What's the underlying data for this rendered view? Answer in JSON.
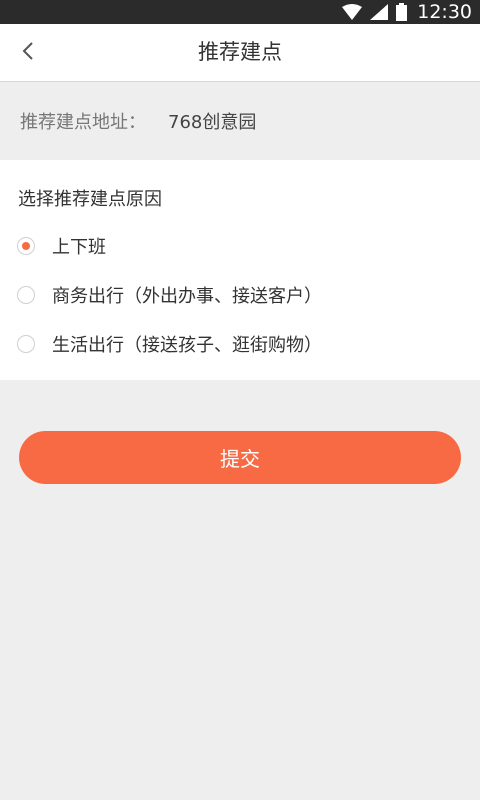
{
  "status_bar": {
    "time": "12:30",
    "icons": [
      "wifi-icon",
      "cell-signal-icon",
      "battery-icon"
    ]
  },
  "header": {
    "back_icon": "chevron-left-icon",
    "title": "推荐建点"
  },
  "address": {
    "label": "推荐建点地址：",
    "value": "768创意园"
  },
  "reason": {
    "title": "选择推荐建点原因",
    "options": [
      {
        "label": "上下班",
        "selected": true
      },
      {
        "label": "商务出行（外出办事、接送客户）",
        "selected": false
      },
      {
        "label": "生活出行（接送孩子、逛街购物）",
        "selected": false
      }
    ]
  },
  "submit": {
    "label": "提交"
  },
  "colors": {
    "accent": "#f76a43",
    "background": "#eeeeee",
    "status_bar": "#2b2b2b"
  }
}
